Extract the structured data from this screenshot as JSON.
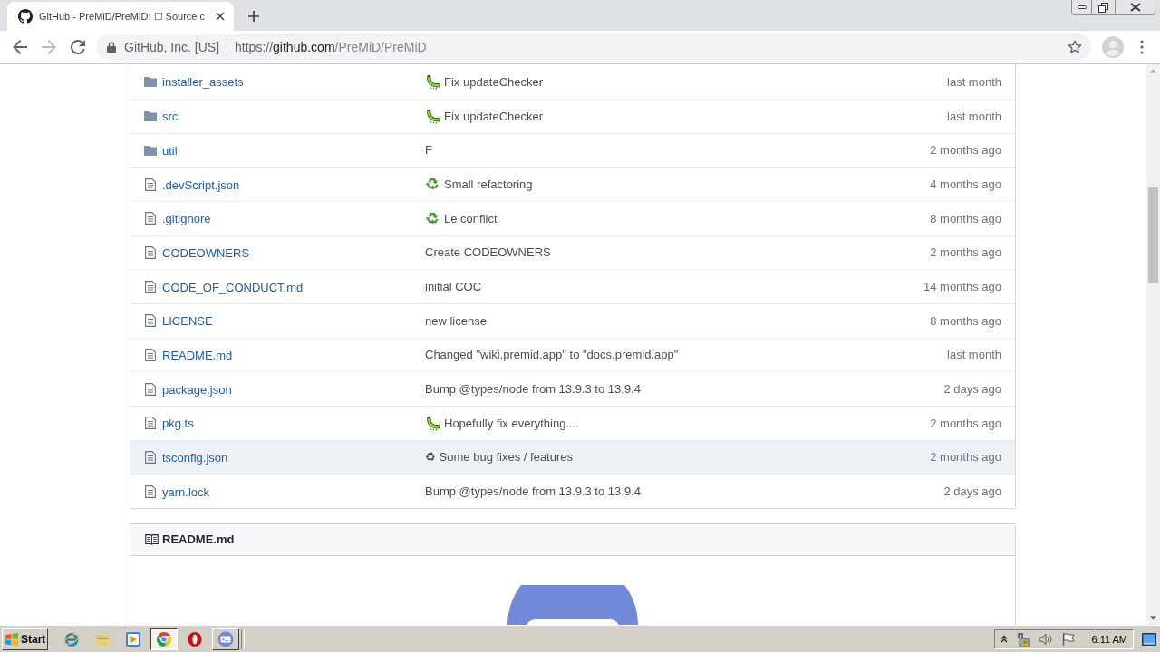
{
  "tabs": [
    {
      "title": "GitHub - PreMiD/PreMiD: ☐ Source c",
      "selected": true
    }
  ],
  "toolbar": {
    "nav": [
      {
        "kind": "back",
        "disabled": false
      },
      {
        "kind": "forward",
        "disabled": true
      },
      {
        "kind": "reload",
        "disabled": false
      }
    ],
    "site_identity": "GitHub, Inc. [US]",
    "url": {
      "scheme": "https://",
      "host": "github.com",
      "path": "/PreMiD/PreMiD"
    }
  },
  "files": [
    {
      "kind": "dir",
      "name": "installer_assets",
      "emoji": {
        "kind": "bug"
      },
      "message": "Fix updateChecker",
      "age": "last month",
      "hovered": false
    },
    {
      "kind": "dir",
      "name": "src",
      "emoji": {
        "kind": "bug"
      },
      "message": "Fix updateChecker",
      "age": "last month",
      "hovered": false
    },
    {
      "kind": "dir",
      "name": "util",
      "message": "F",
      "age": "2 months ago",
      "hovered": false
    },
    {
      "kind": "file",
      "name": ".devScript.json",
      "emoji": {
        "kind": "recycle"
      },
      "message": "Small refactoring",
      "age": "4 months ago",
      "hovered": false
    },
    {
      "kind": "file",
      "name": ".gitignore",
      "emoji": {
        "kind": "recycle"
      },
      "message": "Le conflict",
      "age": "8 months ago",
      "hovered": false
    },
    {
      "kind": "file",
      "name": "CODEOWNERS",
      "message": "Create CODEOWNERS",
      "age": "2 months ago",
      "hovered": false
    },
    {
      "kind": "file",
      "name": "CODE_OF_CONDUCT.md",
      "message": "initial COC",
      "age": "14 months ago",
      "hovered": false
    },
    {
      "kind": "file",
      "name": "LICENSE",
      "message": "new license",
      "age": "8 months ago",
      "hovered": false
    },
    {
      "kind": "file",
      "name": "README.md",
      "message": "Changed \"wiki.premid.app\" to \"docs.premid.app\"",
      "age": "last month",
      "hovered": false
    },
    {
      "kind": "file",
      "name": "package.json",
      "message": "Bump @types/node from 13.9.3 to 13.9.4",
      "age": "2 days ago",
      "hovered": false
    },
    {
      "kind": "file",
      "name": "pkg.ts",
      "emoji": {
        "kind": "bug"
      },
      "message": "Hopefully fix everything....",
      "age": "2 months ago",
      "hovered": false
    },
    {
      "kind": "file",
      "name": "tsconfig.json",
      "message": "♻ Some bug fixes / features",
      "age": "2 months ago",
      "hovered": true
    },
    {
      "kind": "file",
      "name": "yarn.lock",
      "message": "Bump @types/node from 13.9.3 to 13.9.4",
      "age": "2 days ago",
      "hovered": false
    }
  ],
  "readme": {
    "title": "README.md"
  },
  "taskbar": {
    "start_label": "Start",
    "apps": [
      {
        "kind": "ie",
        "open": false,
        "selected": false
      },
      {
        "kind": "explorer",
        "open": false,
        "selected": false
      },
      {
        "kind": "media",
        "open": false,
        "selected": false
      },
      {
        "kind": "chrome",
        "open": true,
        "selected": true
      },
      {
        "kind": "opera",
        "open": false,
        "selected": false
      },
      {
        "kind": "console",
        "open": true,
        "selected": false
      }
    ],
    "clock": "6:11 AM"
  }
}
